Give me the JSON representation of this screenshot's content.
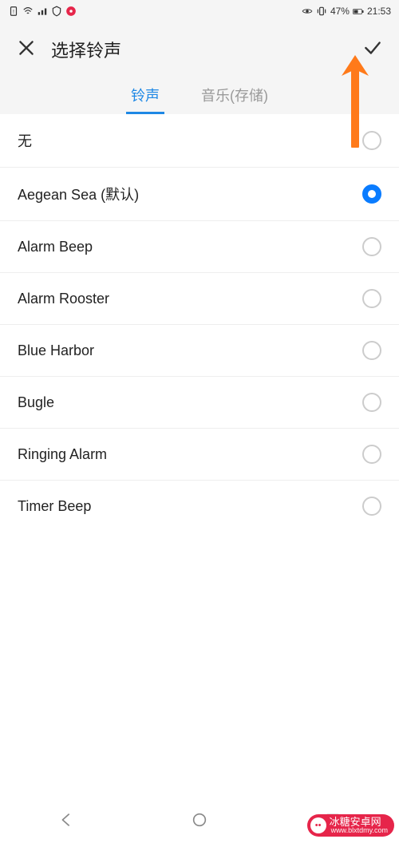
{
  "status": {
    "battery": "47%",
    "time": "21:53"
  },
  "header": {
    "title": "选择铃声"
  },
  "tabs": {
    "ringtone": "铃声",
    "music": "音乐(存储)"
  },
  "ringtones": [
    {
      "label": "无",
      "selected": false
    },
    {
      "label": "Aegean Sea (默认)",
      "selected": true
    },
    {
      "label": "Alarm Beep",
      "selected": false
    },
    {
      "label": "Alarm Rooster",
      "selected": false
    },
    {
      "label": "Blue Harbor",
      "selected": false
    },
    {
      "label": "Bugle",
      "selected": false
    },
    {
      "label": "Ringing Alarm",
      "selected": false
    },
    {
      "label": "Timer Beep",
      "selected": false
    }
  ],
  "watermark": {
    "brand": "冰糖安卓网",
    "url": "www.blxtdmy.com"
  }
}
